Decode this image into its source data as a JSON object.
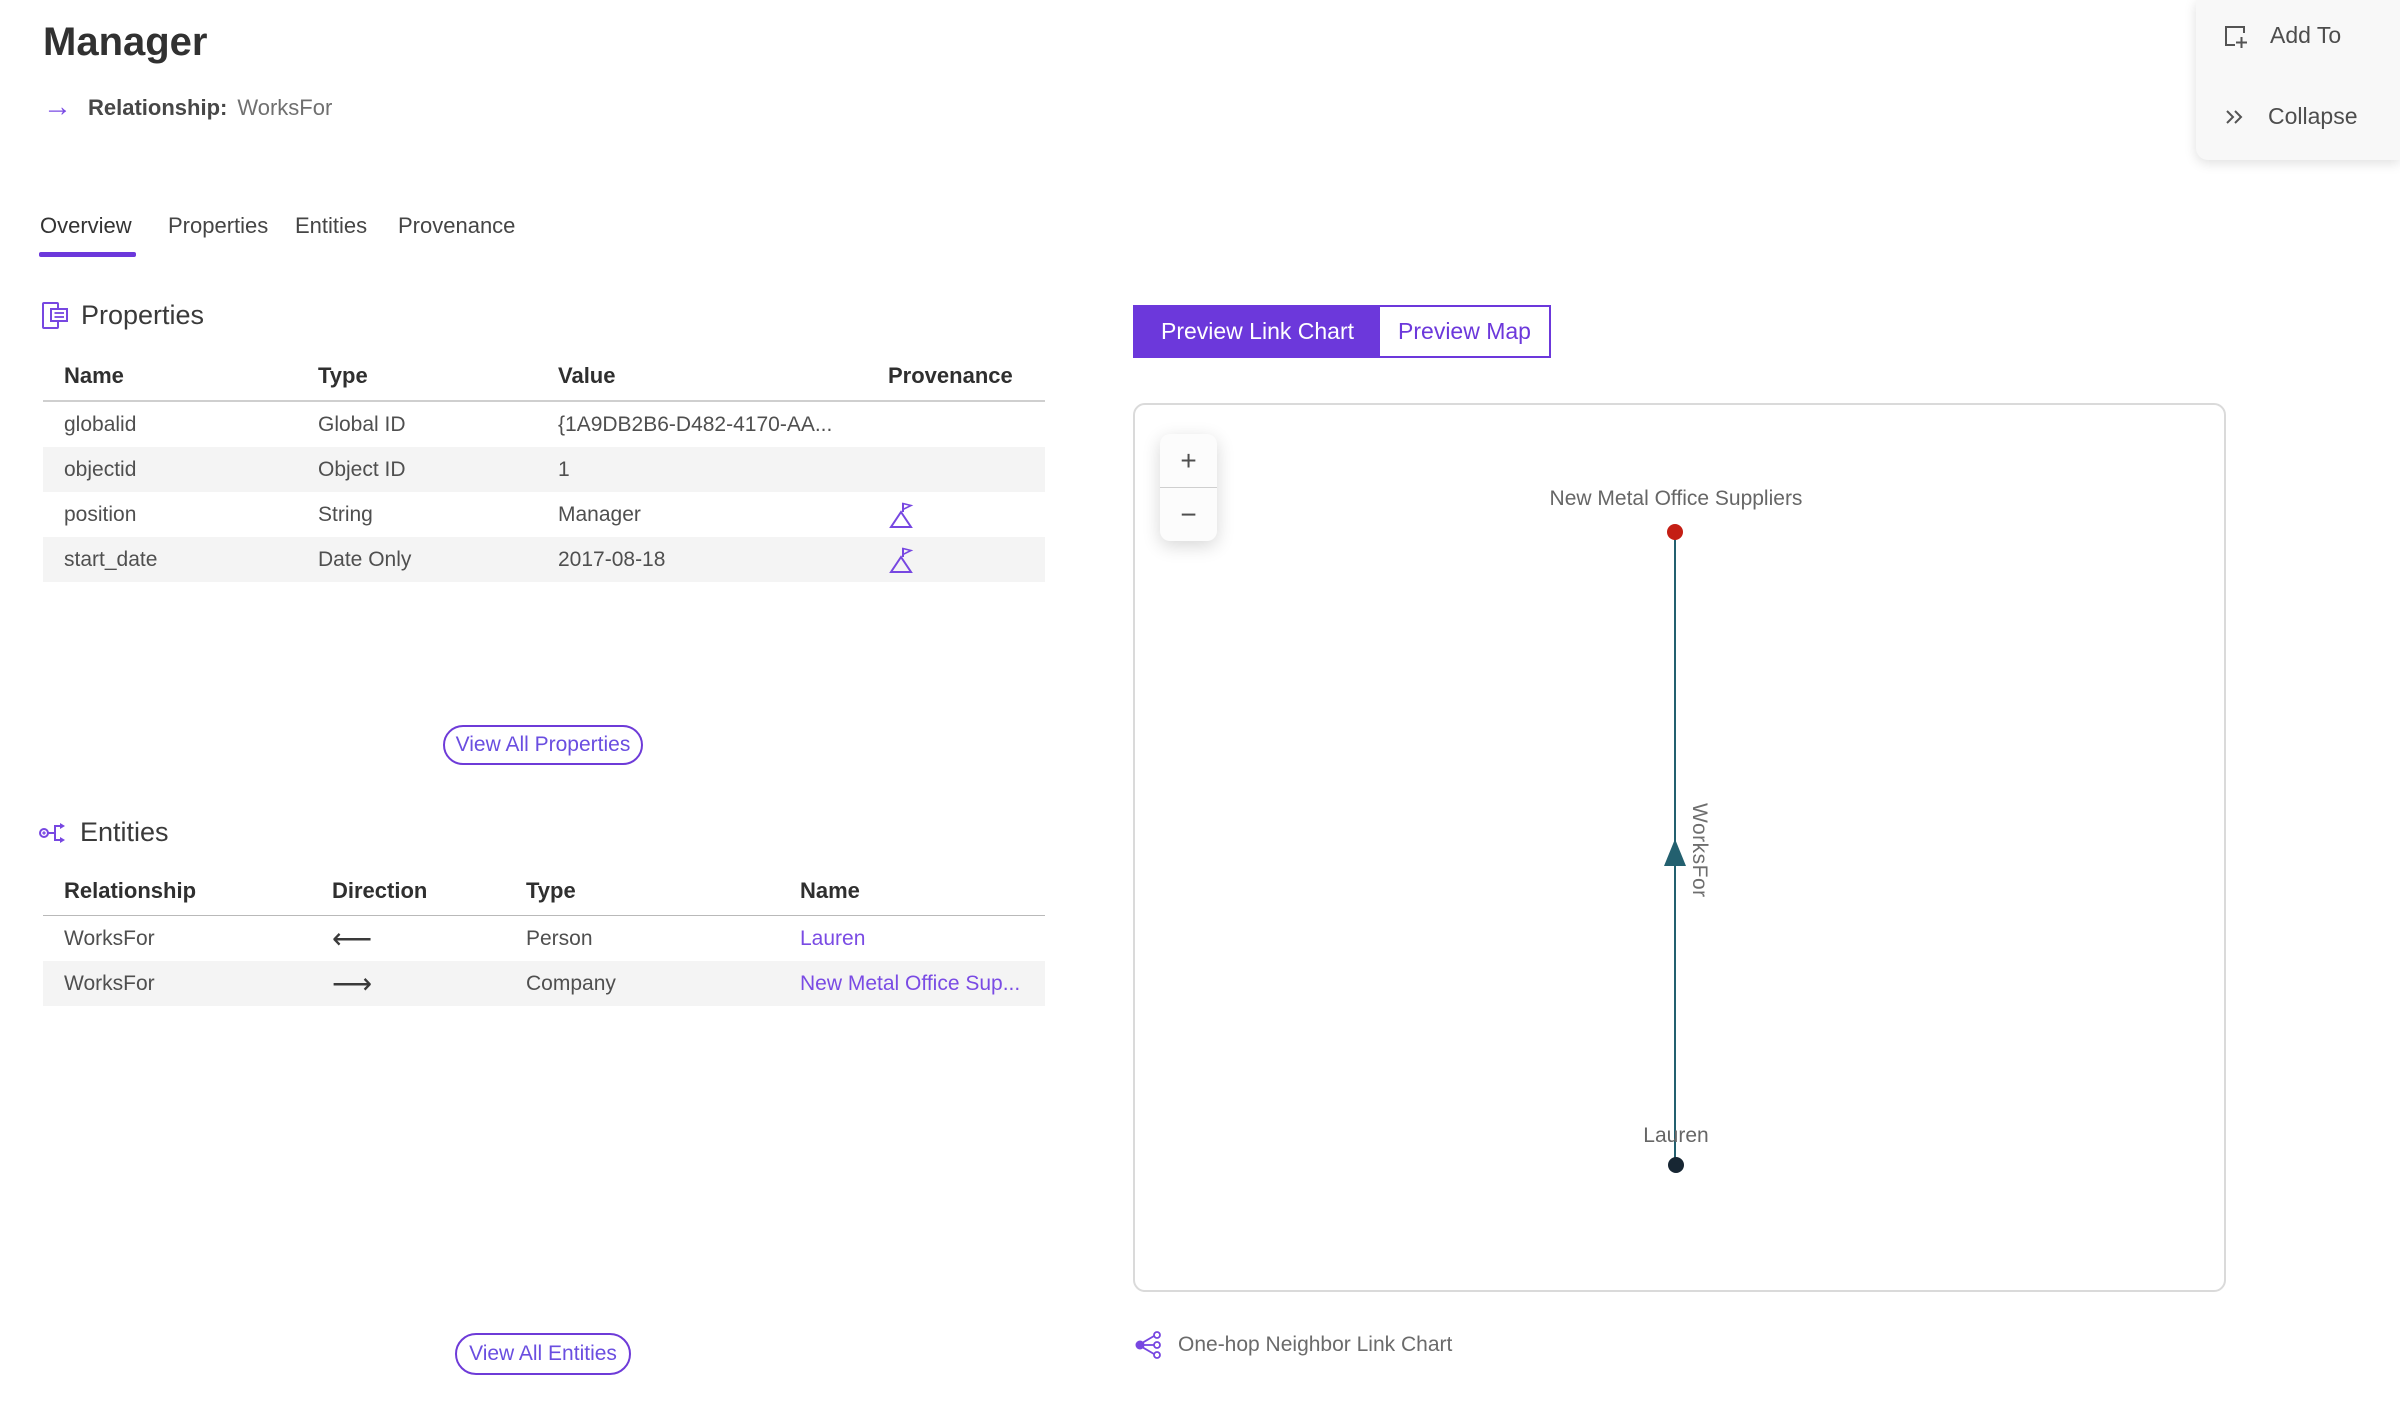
{
  "header": {
    "title": "Manager",
    "subtitle_label": "Relationship:",
    "subtitle_value": "WorksFor"
  },
  "actions": {
    "add_to_label": "Add To",
    "collapse_label": "Collapse"
  },
  "tabs": [
    {
      "label": "Overview",
      "active": true
    },
    {
      "label": "Properties",
      "active": false
    },
    {
      "label": "Entities",
      "active": false
    },
    {
      "label": "Provenance",
      "active": false
    }
  ],
  "properties_section": {
    "title": "Properties",
    "columns": [
      "Name",
      "Type",
      "Value",
      "Provenance"
    ],
    "rows": [
      {
        "name": "globalid",
        "type": "Global ID",
        "value": "{1A9DB2B6-D482-4170-AA...",
        "has_provenance": false
      },
      {
        "name": "objectid",
        "type": "Object ID",
        "value": "1",
        "has_provenance": false
      },
      {
        "name": "position",
        "type": "String",
        "value": "Manager",
        "has_provenance": true
      },
      {
        "name": "start_date",
        "type": "Date Only",
        "value": "2017-08-18",
        "has_provenance": true
      }
    ],
    "view_all_label": "View All Properties"
  },
  "entities_section": {
    "title": "Entities",
    "columns": [
      "Relationship",
      "Direction",
      "Type",
      "Name"
    ],
    "rows": [
      {
        "relationship": "WorksFor",
        "direction": "incoming",
        "direction_glyph": "⟵",
        "type": "Person",
        "name": "Lauren"
      },
      {
        "relationship": "WorksFor",
        "direction": "outgoing",
        "direction_glyph": "⟶",
        "type": "Company",
        "name": "New Metal Office Sup..."
      }
    ],
    "view_all_label": "View All Entities"
  },
  "preview": {
    "toggle": [
      {
        "label": "Preview Link Chart",
        "active": true
      },
      {
        "label": "Preview Map",
        "active": false
      }
    ],
    "zoom_in_label": "+",
    "zoom_out_label": "−",
    "chart": {
      "top_node_label": "New Metal Office Suppliers",
      "bottom_node_label": "Lauren",
      "edge_label": "WorksFor"
    },
    "caption": "One-hop Neighbor Link Chart"
  },
  "colors": {
    "accent": "#6c38db",
    "link": "#7a4be4",
    "edge": "#23606f",
    "node-top": "#c41e14",
    "node-bottom": "#172633",
    "icon-gray": "#545454"
  }
}
